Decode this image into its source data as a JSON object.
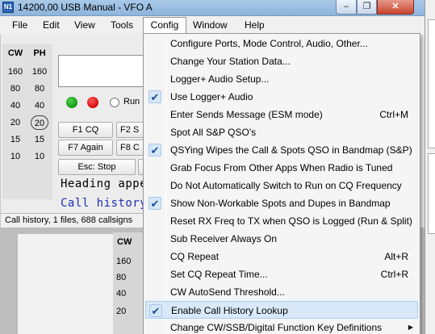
{
  "window": {
    "title": "14200,00 USB Manual - VFO A",
    "icon_text": "N1",
    "min": "–",
    "max": "❐",
    "close": "✕"
  },
  "menubar": {
    "file": "File",
    "edit": "Edit",
    "view": "View",
    "tools": "Tools",
    "config": "Config",
    "window": "Window",
    "help": "Help"
  },
  "bands": {
    "cw_head": "CW",
    "ph_head": "PH",
    "rows": [
      {
        "cw": "160",
        "ph": "160"
      },
      {
        "cw": "80",
        "ph": "80"
      },
      {
        "cw": "40",
        "ph": "40"
      },
      {
        "cw": "20",
        "ph": "20"
      },
      {
        "cw": "15",
        "ph": "15"
      },
      {
        "cw": "10",
        "ph": "10"
      }
    ]
  },
  "entry": {
    "run_label": "Run"
  },
  "fkeys": {
    "f1": "F1 CQ",
    "f2": "F2 S",
    "f7": "F7 Again",
    "f8": "F8 C",
    "esc": "Esc: Stop"
  },
  "info": {
    "heading": "Heading appe",
    "callhist": "Call history"
  },
  "status": {
    "text": "Call history, 1 files, 688 callsigns"
  },
  "lower": {
    "cw": "CW",
    "bands": [
      "160",
      "80",
      "40",
      "20"
    ]
  },
  "config_menu": {
    "items": [
      {
        "label": "Configure Ports, Mode Control, Audio, Other...",
        "checked": false,
        "shortcut": ""
      },
      {
        "label": "Change Your Station Data...",
        "checked": false,
        "shortcut": ""
      },
      {
        "label": "Logger+ Audio Setup...",
        "checked": false,
        "shortcut": ""
      },
      {
        "label": "Use Logger+ Audio",
        "checked": true,
        "shortcut": ""
      },
      {
        "label": "Enter Sends Message (ESM mode)",
        "checked": false,
        "shortcut": "Ctrl+M"
      },
      {
        "label": "Spot All S&P QSO's",
        "checked": false,
        "shortcut": ""
      },
      {
        "label": "QSYing Wipes the Call & Spots QSO in Bandmap (S&P)",
        "checked": true,
        "shortcut": ""
      },
      {
        "label": "Grab Focus From Other Apps When Radio is Tuned",
        "checked": false,
        "shortcut": ""
      },
      {
        "label": "Do Not Automatically Switch to Run on CQ Frequency",
        "checked": false,
        "shortcut": ""
      },
      {
        "label": "Show Non-Workable Spots and Dupes in Bandmap",
        "checked": true,
        "shortcut": ""
      },
      {
        "label": "Reset RX Freq to TX when QSO is Logged (Run & Split)",
        "checked": false,
        "shortcut": ""
      },
      {
        "label": "Sub Receiver Always On",
        "checked": false,
        "shortcut": ""
      },
      {
        "label": "CQ Repeat",
        "checked": false,
        "shortcut": "Alt+R"
      },
      {
        "label": "Set CQ Repeat Time...",
        "checked": false,
        "shortcut": "Ctrl+R"
      },
      {
        "label": "CW AutoSend Threshold...",
        "checked": false,
        "shortcut": ""
      },
      {
        "label": "Enable Call History Lookup",
        "checked": true,
        "shortcut": "",
        "highlighted": true
      },
      {
        "label": "Change CW/SSB/Digital Function Key Definitions",
        "checked": false,
        "shortcut": "",
        "submenu": true
      }
    ],
    "check_glyph": "✔",
    "submenu_glyph": "▶"
  }
}
